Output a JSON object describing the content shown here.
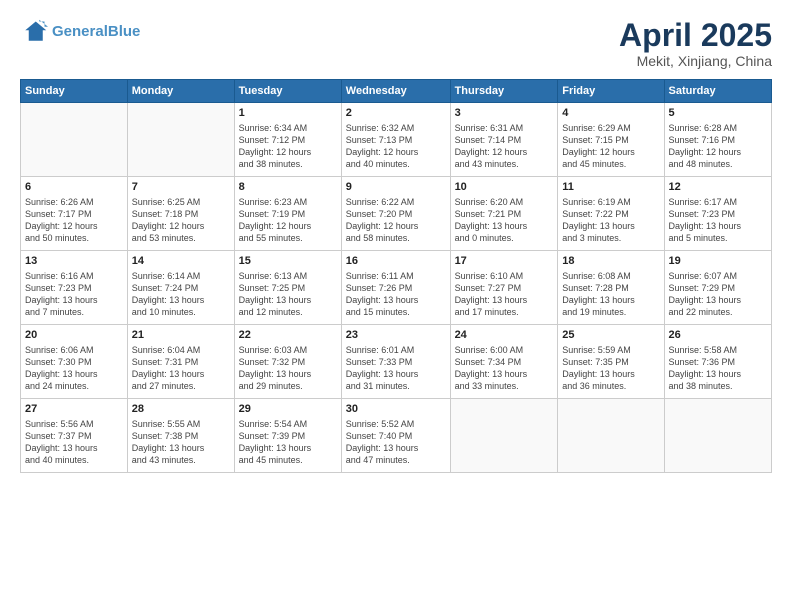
{
  "logo": {
    "line1": "General",
    "line2": "Blue"
  },
  "title": "April 2025",
  "subtitle": "Mekit, Xinjiang, China",
  "days_header": [
    "Sunday",
    "Monday",
    "Tuesday",
    "Wednesday",
    "Thursday",
    "Friday",
    "Saturday"
  ],
  "weeks": [
    [
      {
        "day": "",
        "info": ""
      },
      {
        "day": "",
        "info": ""
      },
      {
        "day": "1",
        "info": "Sunrise: 6:34 AM\nSunset: 7:12 PM\nDaylight: 12 hours\nand 38 minutes."
      },
      {
        "day": "2",
        "info": "Sunrise: 6:32 AM\nSunset: 7:13 PM\nDaylight: 12 hours\nand 40 minutes."
      },
      {
        "day": "3",
        "info": "Sunrise: 6:31 AM\nSunset: 7:14 PM\nDaylight: 12 hours\nand 43 minutes."
      },
      {
        "day": "4",
        "info": "Sunrise: 6:29 AM\nSunset: 7:15 PM\nDaylight: 12 hours\nand 45 minutes."
      },
      {
        "day": "5",
        "info": "Sunrise: 6:28 AM\nSunset: 7:16 PM\nDaylight: 12 hours\nand 48 minutes."
      }
    ],
    [
      {
        "day": "6",
        "info": "Sunrise: 6:26 AM\nSunset: 7:17 PM\nDaylight: 12 hours\nand 50 minutes."
      },
      {
        "day": "7",
        "info": "Sunrise: 6:25 AM\nSunset: 7:18 PM\nDaylight: 12 hours\nand 53 minutes."
      },
      {
        "day": "8",
        "info": "Sunrise: 6:23 AM\nSunset: 7:19 PM\nDaylight: 12 hours\nand 55 minutes."
      },
      {
        "day": "9",
        "info": "Sunrise: 6:22 AM\nSunset: 7:20 PM\nDaylight: 12 hours\nand 58 minutes."
      },
      {
        "day": "10",
        "info": "Sunrise: 6:20 AM\nSunset: 7:21 PM\nDaylight: 13 hours\nand 0 minutes."
      },
      {
        "day": "11",
        "info": "Sunrise: 6:19 AM\nSunset: 7:22 PM\nDaylight: 13 hours\nand 3 minutes."
      },
      {
        "day": "12",
        "info": "Sunrise: 6:17 AM\nSunset: 7:23 PM\nDaylight: 13 hours\nand 5 minutes."
      }
    ],
    [
      {
        "day": "13",
        "info": "Sunrise: 6:16 AM\nSunset: 7:23 PM\nDaylight: 13 hours\nand 7 minutes."
      },
      {
        "day": "14",
        "info": "Sunrise: 6:14 AM\nSunset: 7:24 PM\nDaylight: 13 hours\nand 10 minutes."
      },
      {
        "day": "15",
        "info": "Sunrise: 6:13 AM\nSunset: 7:25 PM\nDaylight: 13 hours\nand 12 minutes."
      },
      {
        "day": "16",
        "info": "Sunrise: 6:11 AM\nSunset: 7:26 PM\nDaylight: 13 hours\nand 15 minutes."
      },
      {
        "day": "17",
        "info": "Sunrise: 6:10 AM\nSunset: 7:27 PM\nDaylight: 13 hours\nand 17 minutes."
      },
      {
        "day": "18",
        "info": "Sunrise: 6:08 AM\nSunset: 7:28 PM\nDaylight: 13 hours\nand 19 minutes."
      },
      {
        "day": "19",
        "info": "Sunrise: 6:07 AM\nSunset: 7:29 PM\nDaylight: 13 hours\nand 22 minutes."
      }
    ],
    [
      {
        "day": "20",
        "info": "Sunrise: 6:06 AM\nSunset: 7:30 PM\nDaylight: 13 hours\nand 24 minutes."
      },
      {
        "day": "21",
        "info": "Sunrise: 6:04 AM\nSunset: 7:31 PM\nDaylight: 13 hours\nand 27 minutes."
      },
      {
        "day": "22",
        "info": "Sunrise: 6:03 AM\nSunset: 7:32 PM\nDaylight: 13 hours\nand 29 minutes."
      },
      {
        "day": "23",
        "info": "Sunrise: 6:01 AM\nSunset: 7:33 PM\nDaylight: 13 hours\nand 31 minutes."
      },
      {
        "day": "24",
        "info": "Sunrise: 6:00 AM\nSunset: 7:34 PM\nDaylight: 13 hours\nand 33 minutes."
      },
      {
        "day": "25",
        "info": "Sunrise: 5:59 AM\nSunset: 7:35 PM\nDaylight: 13 hours\nand 36 minutes."
      },
      {
        "day": "26",
        "info": "Sunrise: 5:58 AM\nSunset: 7:36 PM\nDaylight: 13 hours\nand 38 minutes."
      }
    ],
    [
      {
        "day": "27",
        "info": "Sunrise: 5:56 AM\nSunset: 7:37 PM\nDaylight: 13 hours\nand 40 minutes."
      },
      {
        "day": "28",
        "info": "Sunrise: 5:55 AM\nSunset: 7:38 PM\nDaylight: 13 hours\nand 43 minutes."
      },
      {
        "day": "29",
        "info": "Sunrise: 5:54 AM\nSunset: 7:39 PM\nDaylight: 13 hours\nand 45 minutes."
      },
      {
        "day": "30",
        "info": "Sunrise: 5:52 AM\nSunset: 7:40 PM\nDaylight: 13 hours\nand 47 minutes."
      },
      {
        "day": "",
        "info": ""
      },
      {
        "day": "",
        "info": ""
      },
      {
        "day": "",
        "info": ""
      }
    ]
  ]
}
